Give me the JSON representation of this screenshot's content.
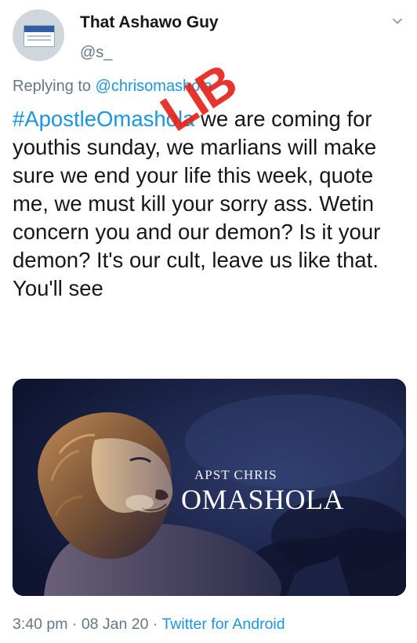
{
  "author": {
    "name": "That Ashawo Guy",
    "handle": "@s_"
  },
  "reply": {
    "prefix": "Replying to ",
    "mention": "@chrisomashola"
  },
  "tweet": {
    "hashtag": "#ApostleOmashola",
    "text": " we are coming for youthis sunday, we marlians will make sure we end your life this week, quote me, we must kill your sorry ass. Wetin concern you and our demon? Is it your demon? It's our cult, leave us like that. You'll see"
  },
  "media": {
    "caption_line1": "APST CHRIS",
    "caption_line2": "OMASHOLA"
  },
  "meta": {
    "time": "3:40 pm",
    "separator": " · ",
    "date": "08 Jan 20",
    "source": "Twitter for Android"
  },
  "watermark": "LIB",
  "colors": {
    "link": "#1b95e0",
    "secondary_text": "#657786",
    "primary_text": "#14171a",
    "watermark": "#e3241b",
    "media_bg": "#1a2344"
  },
  "icons": {
    "more": "chevron-down-icon"
  }
}
